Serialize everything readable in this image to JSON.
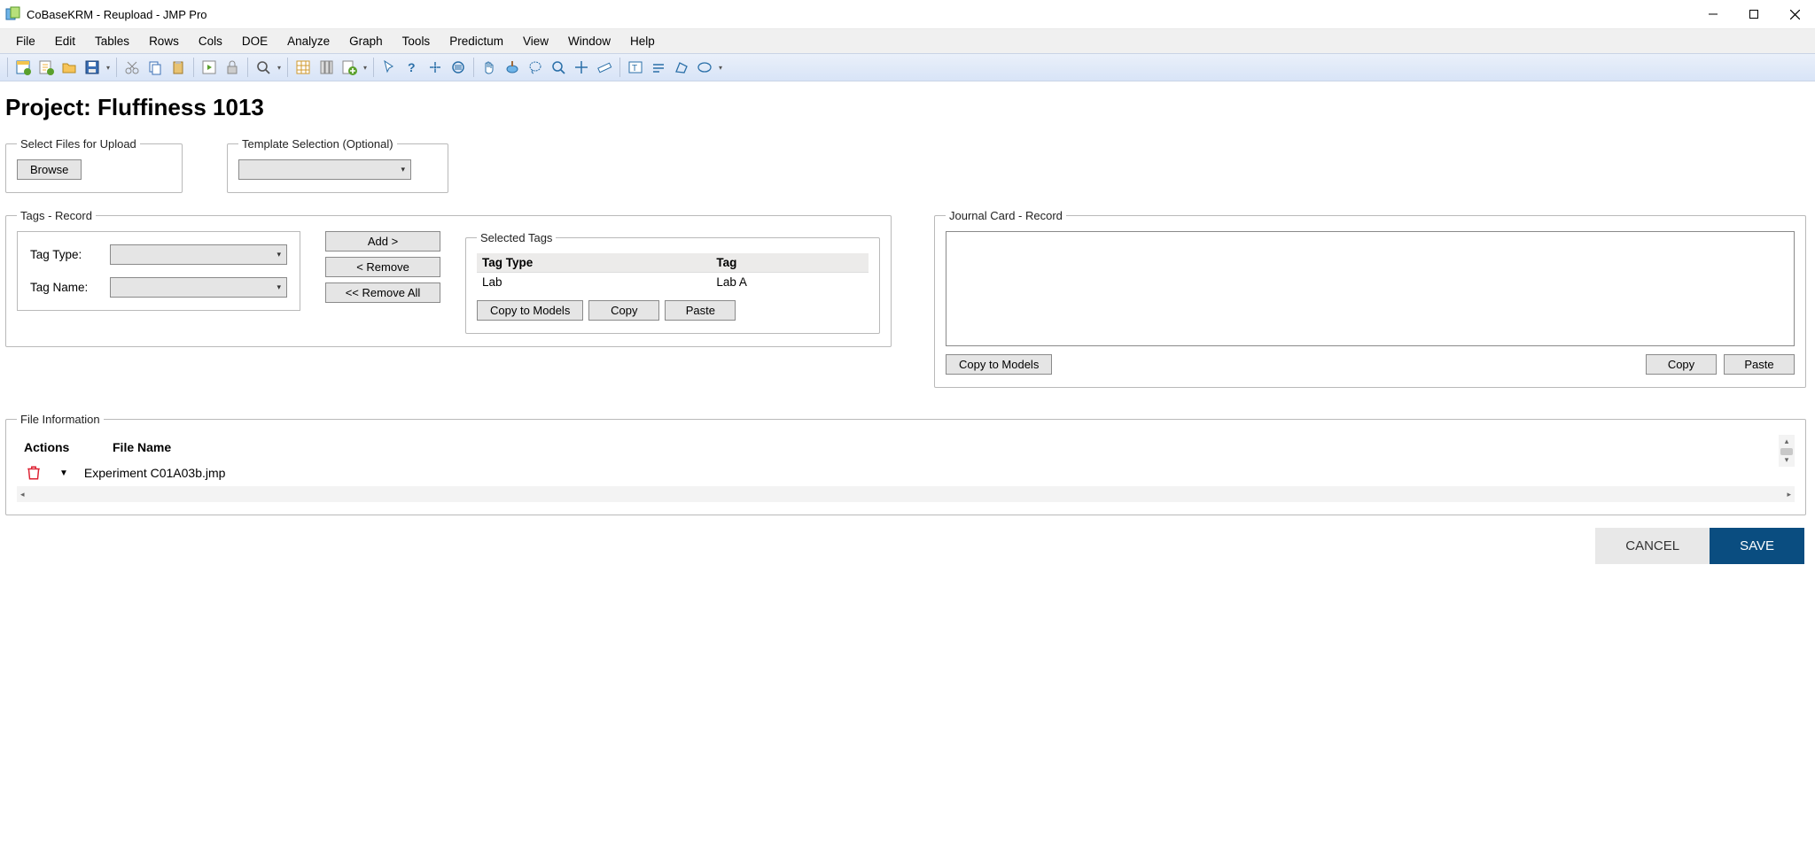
{
  "window": {
    "title": "CoBaseKRM - Reupload - JMP Pro"
  },
  "menus": [
    "File",
    "Edit",
    "Tables",
    "Rows",
    "Cols",
    "DOE",
    "Analyze",
    "Graph",
    "Tools",
    "Predictum",
    "View",
    "Window",
    "Help"
  ],
  "project_heading": "Project: Fluffiness 1013",
  "file_upload": {
    "legend": "Select Files for Upload",
    "browse": "Browse"
  },
  "template": {
    "legend": "Template Selection (Optional)",
    "value": ""
  },
  "tags_record": {
    "legend": "Tags - Record",
    "tag_type_label": "Tag Type:",
    "tag_name_label": "Tag Name:",
    "tag_type_value": "",
    "tag_name_value": "",
    "add": "Add >",
    "remove": "< Remove",
    "remove_all": "<< Remove All",
    "selected_legend": "Selected Tags",
    "col_type": "Tag Type",
    "col_tag": "Tag",
    "rows": [
      {
        "type": "Lab",
        "tag": "Lab A"
      }
    ],
    "copy_to_models": "Copy to Models",
    "copy": "Copy",
    "paste": "Paste"
  },
  "journal": {
    "legend": "Journal Card - Record",
    "text": "",
    "copy_to_models": "Copy to Models",
    "copy": "Copy",
    "paste": "Paste"
  },
  "file_info": {
    "legend": "File Information",
    "col_actions": "Actions",
    "col_filename": "File Name",
    "rows": [
      {
        "name": "Experiment C01A03b.jmp"
      }
    ]
  },
  "footer": {
    "cancel": "CANCEL",
    "save": "SAVE"
  }
}
